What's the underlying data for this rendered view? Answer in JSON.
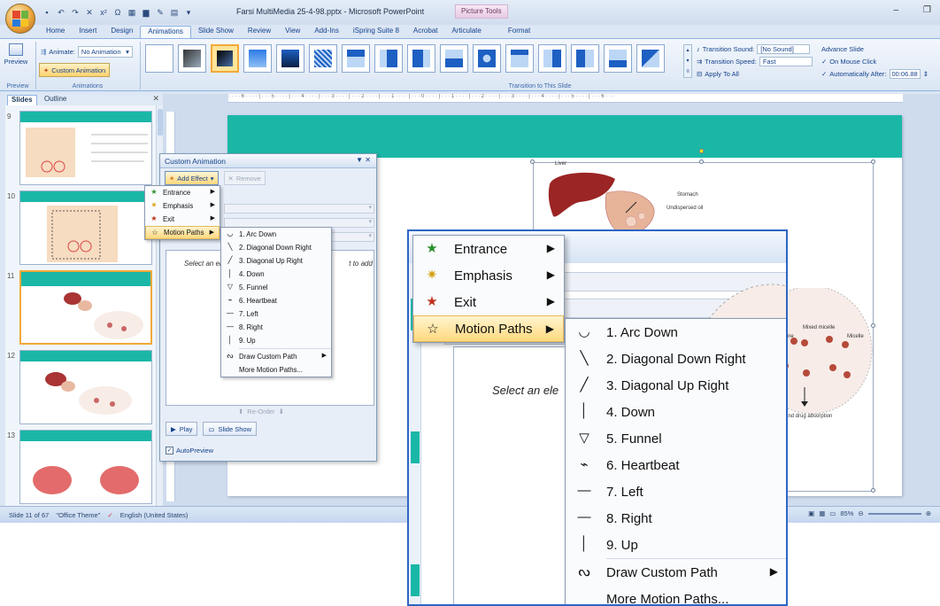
{
  "window": {
    "title": "Farsi MultiMedia 25-4-98.pptx - Microsoft PowerPoint",
    "context_tab": "Picture Tools"
  },
  "tabs": [
    "Home",
    "Insert",
    "Design",
    "Animations",
    "Slide Show",
    "Review",
    "View",
    "Add-Ins",
    "iSpring Suite 8",
    "Acrobat",
    "Articulate",
    "Format"
  ],
  "ribbon": {
    "preview_label": "Preview",
    "animate_label": "Animate:",
    "animate_value": "No Animation",
    "custom_animation_label": "Custom Animation",
    "group_preview": "Preview",
    "group_animations": "Animations",
    "group_transition": "Transition to This Slide",
    "transition_sound_label": "Transition Sound:",
    "transition_sound_value": "[No Sound]",
    "transition_speed_label": "Transition Speed:",
    "transition_speed_value": "Fast",
    "apply_to_all": "Apply To All",
    "advance_slide": "Advance Slide",
    "on_mouse_click": "On Mouse Click",
    "auto_after_label": "Automatically After:",
    "auto_after_value": "00:06.88"
  },
  "slides_pane": {
    "tab_slides": "Slides",
    "tab_outline": "Outline",
    "numbers": [
      "9",
      "10",
      "11",
      "12",
      "13"
    ]
  },
  "slide": {
    "labels": {
      "liver": "Liver",
      "stomach": "Stomach",
      "undispersed_oil": "Undispersed oil",
      "mixed_micelle": "Mixed micelle",
      "micelle": "Micelle",
      "tine": "tine",
      "absorption": "and drug absorption"
    }
  },
  "custom_animation": {
    "title": "Custom Animation",
    "add_effect": "Add Effect",
    "remove": "Remove",
    "hint": "Select an ele",
    "hint_suffix": "t to add",
    "reorder": "Re-Order",
    "play": "Play",
    "slide_show": "Slide Show",
    "autopreview": "AutoPreview"
  },
  "effect_menu": [
    {
      "label": "Entrance",
      "icon": "entrance-star-icon"
    },
    {
      "label": "Emphasis",
      "icon": "emphasis-star-icon"
    },
    {
      "label": "Exit",
      "icon": "exit-star-icon"
    },
    {
      "label": "Motion Paths",
      "icon": "motion-path-star-icon"
    }
  ],
  "motion_paths": [
    "1. Arc Down",
    "2. Diagonal Down Right",
    "3. Diagonal Up Right",
    "4. Down",
    "5. Funnel",
    "6. Heartbeat",
    "7. Left",
    "8. Right",
    "9. Up",
    "Draw Custom Path",
    "More Motion Paths..."
  ],
  "status": {
    "slide_info": "Slide 11 of 67",
    "theme": "\"Office Theme\"",
    "language": "English (United States)",
    "zoom": "85%"
  },
  "colors": {
    "teal": "#1ab7a7",
    "highlight": "#ffd97e",
    "ribbon": "#dbe6f4"
  }
}
